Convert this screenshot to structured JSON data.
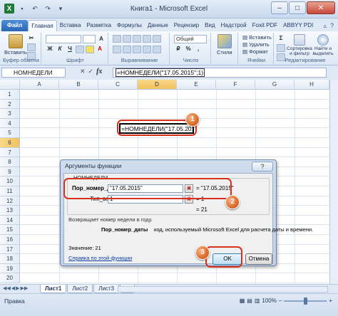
{
  "window": {
    "title": "Книга1 - Microsoft Excel"
  },
  "ribbon_tabs": [
    "Файл",
    "Главная",
    "Вставка",
    "Разметка",
    "Формулы",
    "Данные",
    "Рецензир",
    "Вид",
    "Надстрой",
    "Foxit PDF",
    "ABBYY PDI"
  ],
  "ribbon": {
    "paste_label": "Вставить",
    "clipboard_label": "Буфер обмена",
    "font_label": "Шрифт",
    "alignment_label": "Выравнивание",
    "number_label": "Число",
    "number_format": "Общий",
    "styles_label": "Стили",
    "insert_label": "Вставить",
    "delete_label": "Удалить",
    "format_label": "Формат",
    "cells_label": "Ячейки",
    "sort_label": "Сортировка и фильтр",
    "find_label": "Найти и выделить",
    "editing_label": "Редактирование"
  },
  "formula_bar": {
    "name_box": "НОМНЕДЕЛИ",
    "formula": "=НОМНЕДЕЛИ(\"17.05.2015\";1)"
  },
  "grid": {
    "columns": [
      "A",
      "B",
      "C",
      "D",
      "E",
      "F",
      "G",
      "H"
    ],
    "rows": [
      "1",
      "2",
      "3",
      "4",
      "5",
      "6",
      "7",
      "8",
      "9",
      "10",
      "11",
      "12",
      "13",
      "14",
      "15",
      "16",
      "17",
      "18",
      "19",
      "20"
    ],
    "selected_column": "D",
    "selected_row": "6",
    "active_cell_text": "=НОМНЕДЕЛИ(\"17.05.2015\";1)"
  },
  "dialog": {
    "title": "Аргументы функции",
    "close": "?",
    "group_label": "НОМНЕДЕЛИ",
    "arg1_label": "Пор_номер_даты",
    "arg1_value": "\"17.05.2015\"",
    "arg1_result": "= \"17.05.2015\"",
    "arg2_label": "Тип_возвр",
    "arg2_value": "1",
    "arg2_result": "= 1",
    "total_result": "= 21",
    "description": "Возвращает номер недели в году.",
    "arg_desc_name": "Пор_номер_даты",
    "arg_desc_text": "код, используемый Microsoft Excel для расчета даты и времени.",
    "value_label": "Значение:  21",
    "help_link": "Справка по этой функции",
    "ok_label": "OK",
    "cancel_label": "Отмена"
  },
  "callouts": [
    "1",
    "2",
    "3"
  ],
  "sheets": [
    "Лист1",
    "Лист2",
    "Лист3"
  ],
  "status": {
    "mode": "Правка",
    "zoom": "100%"
  },
  "colors": {
    "callout": "#d9301e",
    "badge": "#e0722e",
    "file_tab": "#2a66b6",
    "excel_green": "#1f7a3a"
  }
}
